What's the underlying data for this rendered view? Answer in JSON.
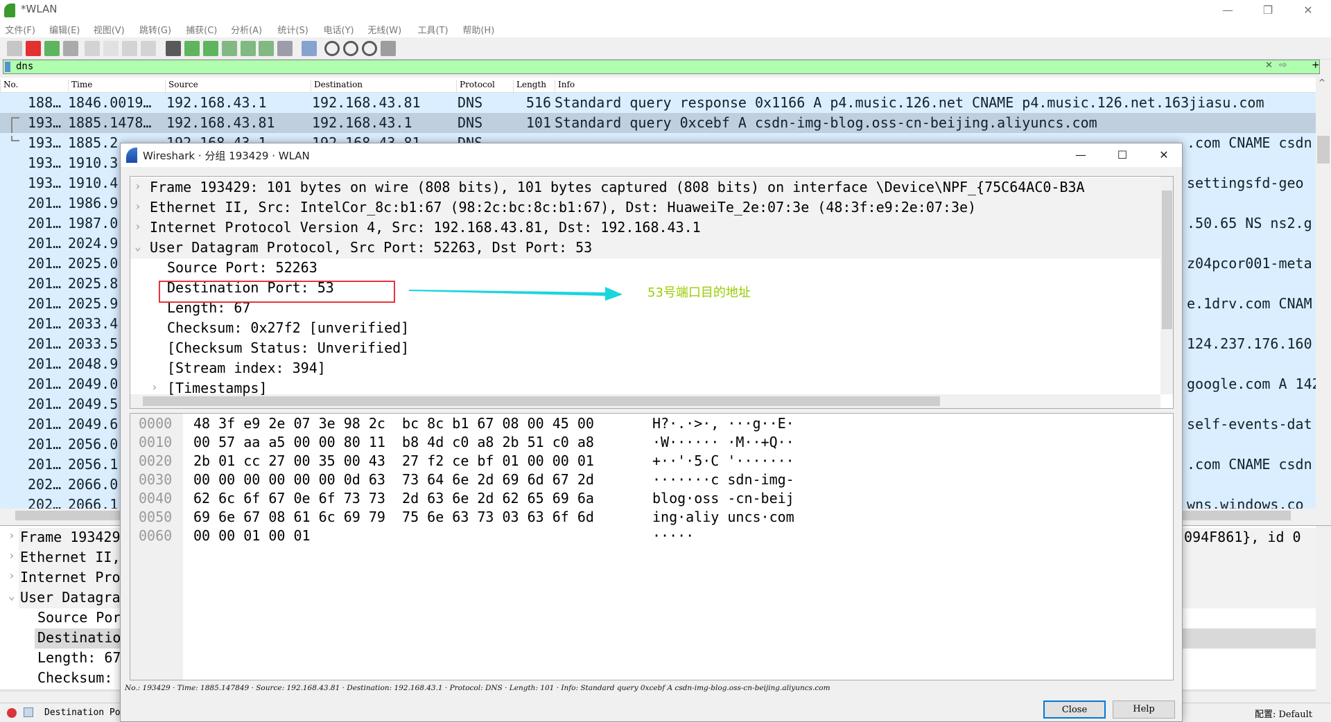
{
  "window": {
    "title": "*WLAN",
    "minimize": "—",
    "maximize": "❐",
    "close": "✕"
  },
  "menu": [
    "文件(F)",
    "编辑(E)",
    "视图(V)",
    "跳转(G)",
    "捕获(C)",
    "分析(A)",
    "统计(S)",
    "电话(Y)",
    "无线(W)",
    "工具(T)",
    "帮助(H)"
  ],
  "toolbar": [
    "shark-fin-icon",
    "stop-icon",
    "restart-icon",
    "options-icon",
    "open-icon",
    "file-icon",
    "close-file-icon",
    "reload-icon",
    "find-icon",
    "back-icon",
    "forward-icon",
    "goto-icon",
    "first-icon",
    "last-icon",
    "autoscroll-icon",
    "colorize-icon",
    "zoom-in-icon",
    "zoom-out-icon",
    "zoom-normal-icon",
    "resize-columns-icon"
  ],
  "filter": {
    "value": "dns",
    "clear": "✕",
    "apply": "⇨",
    "add": "+"
  },
  "columns": [
    "No.",
    "Time",
    "Source",
    "Destination",
    "Protocol",
    "Length",
    "Info"
  ],
  "packets": [
    {
      "no": "188…",
      "time": "1846.0019…",
      "src": "192.168.43.1",
      "dst": "192.168.43.81",
      "proto": "DNS",
      "len": "516",
      "info": "Standard query response 0x1166 A p4.music.126.net CNAME p4.music.126.net.163jiasu.com",
      "tail": ""
    },
    {
      "no": "193…",
      "time": "1885.1478…",
      "src": "192.168.43.81",
      "dst": "192.168.43.1",
      "proto": "DNS",
      "len": "101",
      "info": "Standard query 0xcebf A csdn-img-blog.oss-cn-beijing.aliyuncs.com",
      "tail": "",
      "selected": true
    },
    {
      "no": "193…",
      "time": "1885.2",
      "src": "192.168.43.1",
      "dst": "192.168.43.81",
      "proto": "DNS",
      "len": "",
      "info": "",
      "tail": ".com CNAME csdn"
    },
    {
      "no": "193…",
      "time": "1910.3",
      "tail": ""
    },
    {
      "no": "193…",
      "time": "1910.4",
      "tail": " settingsfd-geo"
    },
    {
      "no": "201…",
      "time": "1986.9",
      "tail": ""
    },
    {
      "no": "201…",
      "time": "1987.0",
      "tail": ".50.65 NS ns2.g"
    },
    {
      "no": "201…",
      "time": "2024.9",
      "tail": ""
    },
    {
      "no": "201…",
      "time": "2025.0",
      "tail": "z04pcor001-meta"
    },
    {
      "no": "201…",
      "time": "2025.8",
      "tail": ""
    },
    {
      "no": "201…",
      "time": "2025.9",
      "tail": "e.1drv.com CNAM"
    },
    {
      "no": "201…",
      "time": "2033.4",
      "tail": ""
    },
    {
      "no": "201…",
      "time": "2033.5",
      "tail": "124.237.176.160"
    },
    {
      "no": "201…",
      "time": "2048.9",
      "tail": ""
    },
    {
      "no": "201…",
      "time": "2049.0",
      "tail": "google.com A 142"
    },
    {
      "no": "201…",
      "time": "2049.5",
      "tail": ""
    },
    {
      "no": "201…",
      "time": "2049.6",
      "tail": "self-events-dat"
    },
    {
      "no": "201…",
      "time": "2056.0",
      "tail": ""
    },
    {
      "no": "201…",
      "time": "2056.1",
      "tail": ".com CNAME csdn"
    },
    {
      "no": "202…",
      "time": "2066.0",
      "tail": ""
    },
    {
      "no": "202…",
      "time": "2066.1",
      "tail": "wns.windows.co"
    }
  ],
  "details": [
    {
      "text": "Frame 193429: 101 bytes on wire (808 bits), 101 bytes captured (808 bits) on interface \\Device\\NPF_{75C64AC0-B3A",
      "tail": "094F861}, id 0",
      "level": 0,
      "expander": "›"
    },
    {
      "text": "Ethernet II, Src: IntelCor_8c:b1:67 (98:2c:bc:8c:b1:67), Dst: HuaweiTe_2e:07:3e (48:3f:e9:2e:07:3e)",
      "level": 0,
      "expander": "›"
    },
    {
      "text": "Internet Protocol Version 4, Src: 192.168.43.81, Dst: 192.168.43.1",
      "level": 0,
      "expander": "›"
    },
    {
      "text": "User Datagram Protocol, Src Port: 52263, Dst Port: 53",
      "level": 0,
      "expander": "⌄"
    },
    {
      "text": "Source Port: 52263",
      "level": 1
    },
    {
      "text": "Destination Port: 53",
      "level": 1,
      "selected": true
    },
    {
      "text": "Length: 67",
      "level": 1
    },
    {
      "text": "Checksum: 0x27f2 [unverified]",
      "level": 1
    }
  ],
  "status": {
    "text": "Destination Port (udp.dstport), 2 bytes",
    "profile": "配置: Default"
  },
  "dialog": {
    "title": "Wireshark · 分组 193429 · WLAN",
    "tree": [
      {
        "text": "Frame 193429: 101 bytes on wire (808 bits), 101 bytes captured (808 bits) on interface \\Device\\NPF_{75C64AC0-B3A",
        "level": 0,
        "expander": "›"
      },
      {
        "text": "Ethernet II, Src: IntelCor_8c:b1:67 (98:2c:bc:8c:b1:67), Dst: HuaweiTe_2e:07:3e (48:3f:e9:2e:07:3e)",
        "level": 0,
        "expander": "›"
      },
      {
        "text": "Internet Protocol Version 4, Src: 192.168.43.81, Dst: 192.168.43.1",
        "level": 0,
        "expander": "›"
      },
      {
        "text": "User Datagram Protocol, Src Port: 52263, Dst Port: 53",
        "level": 0,
        "expander": "⌄"
      },
      {
        "text": "Source Port: 52263",
        "level": 1
      },
      {
        "text": "Destination Port: 53",
        "level": 1
      },
      {
        "text": "Length: 67",
        "level": 1
      },
      {
        "text": "Checksum: 0x27f2 [unverified]",
        "level": 1
      },
      {
        "text": "[Checksum Status: Unverified]",
        "level": 1
      },
      {
        "text": "[Stream index: 394]",
        "level": 1
      },
      {
        "text": "[Timestamps]",
        "level": 1,
        "expander": "›"
      }
    ],
    "hex": [
      {
        "off": "0000",
        "bytes": "48 3f e9 2e 07 3e 98 2c  bc 8c b1 67 08 00 45 00",
        "ascii": "H?·.·>·, ···g··E·"
      },
      {
        "off": "0010",
        "bytes": "00 57 aa a5 00 00 80 11  b8 4d c0 a8 2b 51 c0 a8",
        "ascii": "·W······ ·M··+Q··"
      },
      {
        "off": "0020",
        "bytes": "2b 01 cc 27 00 35 00 43  27 f2 ce bf 01 00 00 01",
        "ascii": "+··'·5·C '·······"
      },
      {
        "off": "0030",
        "bytes": "00 00 00 00 00 00 0d 63  73 64 6e 2d 69 6d 67 2d",
        "ascii": "·······c sdn-img-"
      },
      {
        "off": "0040",
        "bytes": "62 6c 6f 67 0e 6f 73 73  2d 63 6e 2d 62 65 69 6a",
        "ascii": "blog·oss -cn-beij"
      },
      {
        "off": "0050",
        "bytes": "69 6e 67 08 61 6c 69 79  75 6e 63 73 03 63 6f 6d",
        "ascii": "ing·aliy uncs·com"
      },
      {
        "off": "0060",
        "bytes": "00 00 01 00 01",
        "ascii": "·····"
      }
    ],
    "info": "No.: 193429 · Time: 1885.147849 · Source: 192.168.43.81 · Destination: 192.168.43.1 · Protocol: DNS · Length: 101 · Info: Standard query 0xcebf A csdn-img-blog.oss-cn-beijing.aliyuncs.com",
    "close_label": "Close",
    "help_label": "Help",
    "minimize": "—",
    "maximize": "☐",
    "close": "✕"
  },
  "annotation": {
    "text": "53号端口目的地址",
    "color": "#99cc00",
    "arrow_color": "#1ad6dc",
    "box_color": "#e8333a"
  }
}
